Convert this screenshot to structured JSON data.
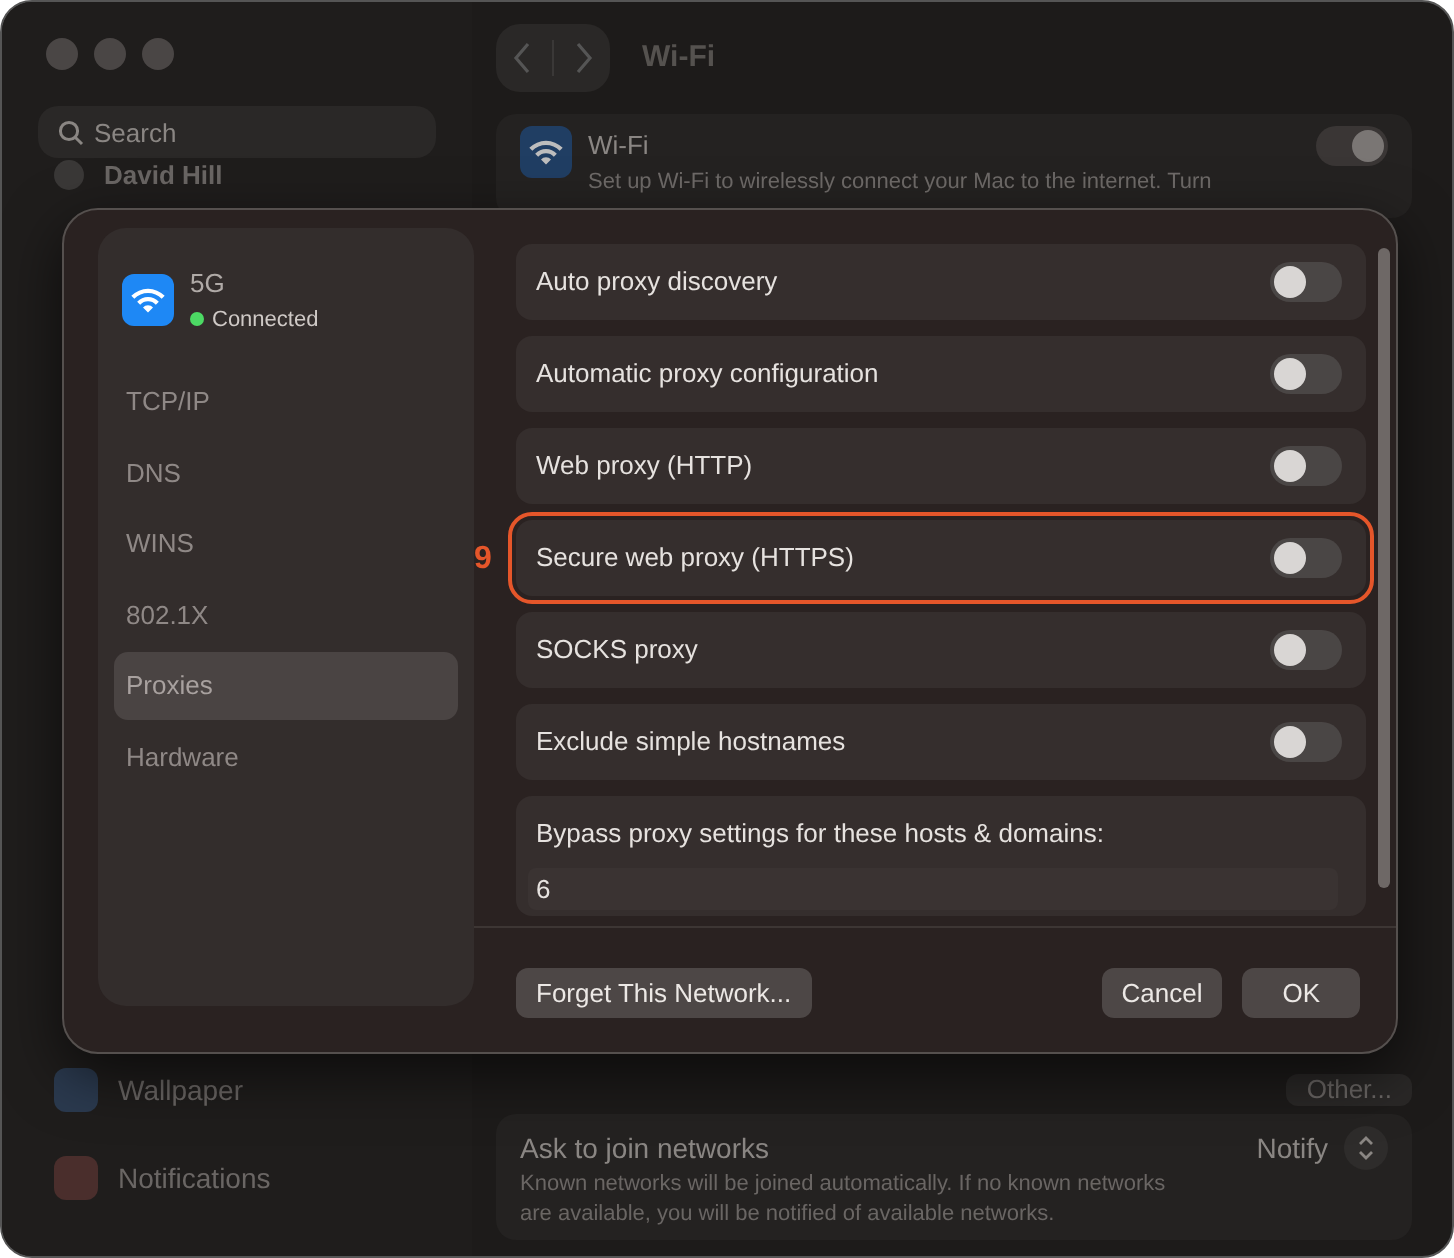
{
  "window": {
    "title": "Wi-Fi"
  },
  "sidebar": {
    "search": {
      "placeholder": "Search"
    },
    "user": "David Hill",
    "items": [
      {
        "label": "Wallpaper",
        "color": "#2b3a4f"
      },
      {
        "label": "Notifications",
        "color": "#4a2e2c"
      }
    ]
  },
  "wifi_card": {
    "title": "Wi-Fi",
    "description": "Set up Wi-Fi to wirelessly connect your Mac to the internet. Turn",
    "on": true
  },
  "other_button": "Other...",
  "ask_to_join": {
    "title": "Ask to join networks",
    "value": "Notify",
    "description": "Known networks will be joined automatically. If no known networks are available, you will be notified of available networks."
  },
  "dialog": {
    "network": {
      "name": "5G",
      "status": "Connected",
      "color": "#4cd964"
    },
    "tabs": [
      {
        "label": "TCP/IP",
        "selected": false
      },
      {
        "label": "DNS",
        "selected": false
      },
      {
        "label": "WINS",
        "selected": false
      },
      {
        "label": "802.1X",
        "selected": false
      },
      {
        "label": "Proxies",
        "selected": true
      },
      {
        "label": "Hardware",
        "selected": false
      }
    ],
    "proxies": [
      {
        "label": "Auto proxy discovery",
        "on": false,
        "highlighted": false
      },
      {
        "label": "Automatic proxy configuration",
        "on": false,
        "highlighted": false
      },
      {
        "label": "Web proxy (HTTP)",
        "on": false,
        "highlighted": false
      },
      {
        "label": "Secure web proxy (HTTPS)",
        "on": false,
        "highlighted": true,
        "annotation": "9"
      },
      {
        "label": "SOCKS proxy",
        "on": false,
        "highlighted": false
      },
      {
        "label": "Exclude simple hostnames",
        "on": false,
        "highlighted": false
      }
    ],
    "bypass": {
      "label": "Bypass proxy settings for these hosts & domains:",
      "value": "6"
    },
    "buttons": {
      "forget": "Forget This Network...",
      "cancel": "Cancel",
      "ok": "OK"
    }
  }
}
